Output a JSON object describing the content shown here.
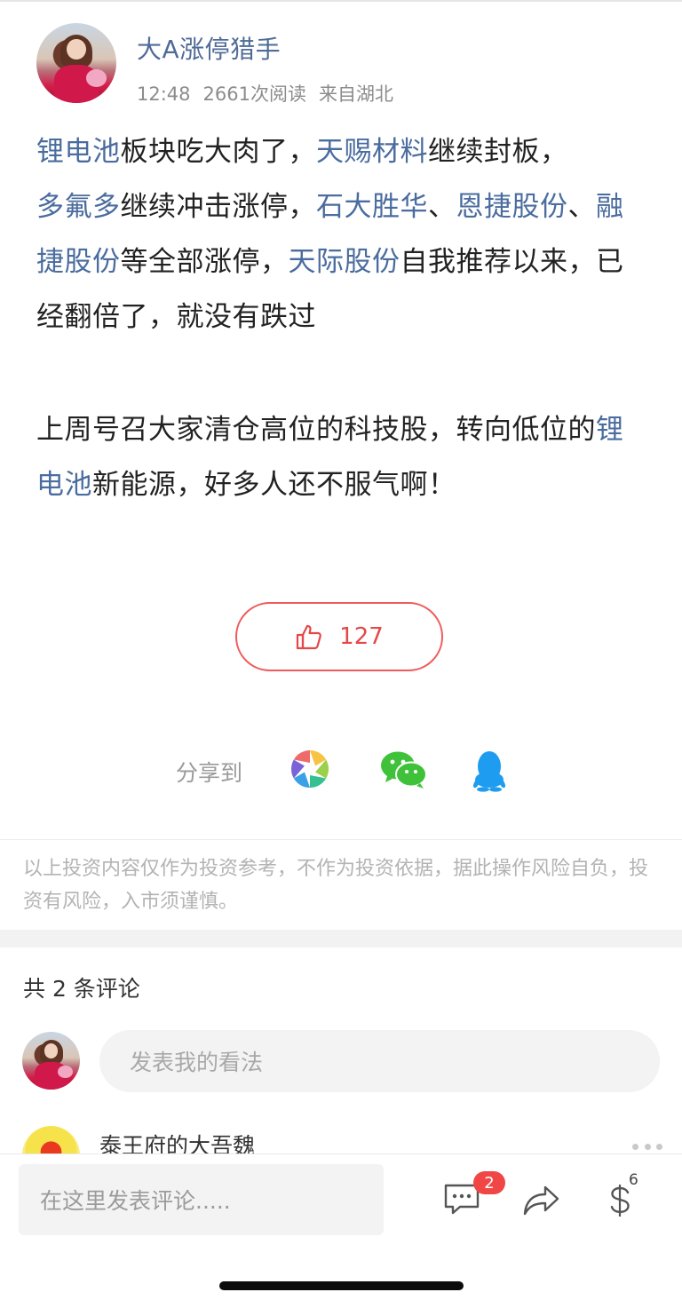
{
  "post": {
    "author": "大A涨停猎手",
    "time": "12:48",
    "reads": "2661次阅读",
    "location": "来自湖北",
    "paragraph1": [
      {
        "text": "锂电池",
        "link": true
      },
      {
        "text": "板块吃大肉了，",
        "link": false
      },
      {
        "text": "天赐材料",
        "link": true
      },
      {
        "text": "继续封板，",
        "link": false
      },
      {
        "text": "多氟多",
        "link": true
      },
      {
        "text": "继续冲击涨停，",
        "link": false
      },
      {
        "text": "石大胜华",
        "link": true
      },
      {
        "text": "、",
        "link": false
      },
      {
        "text": "恩捷股份",
        "link": true
      },
      {
        "text": "、",
        "link": false
      },
      {
        "text": "融捷股份",
        "link": true
      },
      {
        "text": "等全部涨停，",
        "link": false
      },
      {
        "text": "天际股份",
        "link": true
      },
      {
        "text": "自我推荐以来，已经翻倍了，就没有跌过",
        "link": false
      }
    ],
    "paragraph2": [
      {
        "text": "上周号召大家清仓高位的科技股，转向低位的",
        "link": false
      },
      {
        "text": "锂电池",
        "link": true
      },
      {
        "text": "新能源，好多人还不服气啊！",
        "link": false
      }
    ]
  },
  "like": {
    "icon": "thumbs-up-icon",
    "count": "127"
  },
  "share": {
    "label": "分享到",
    "targets": [
      "moments-icon",
      "wechat-icon",
      "qq-icon"
    ]
  },
  "disclaimer": "以上投资内容仅作为投资参考，不作为投资依据，据此操作风险自负，投资有风险，入市须谨慎。",
  "comments": {
    "count_label": "共 2 条评论",
    "input_placeholder": "发表我的看法",
    "first_commenter": "泰王府的大吾魏"
  },
  "bottom_bar": {
    "input_placeholder": "在这里发表评论.....",
    "comment_badge": "2",
    "reward_count": "6"
  },
  "colors": {
    "link": "#4a6c9e",
    "like_red": "#e54848",
    "badge_red": "#f04646"
  }
}
